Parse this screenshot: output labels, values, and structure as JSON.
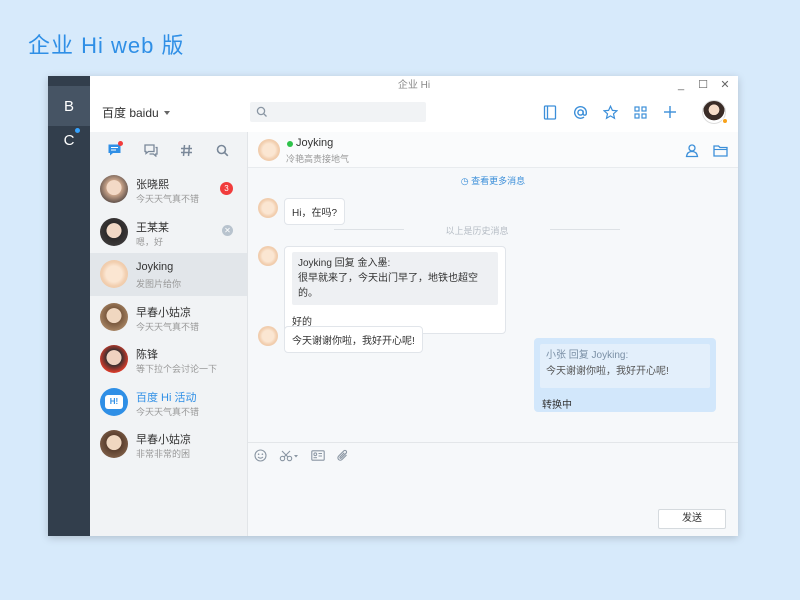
{
  "page_title": "企业 Hi web 版",
  "window": {
    "title": "企业 Hi",
    "controls": [
      "_",
      "☐",
      "✕"
    ]
  },
  "rail": {
    "items": [
      {
        "label": "B",
        "active": true,
        "has_dot": false
      },
      {
        "label": "C",
        "active": false,
        "has_dot": true
      }
    ]
  },
  "topbar": {
    "org_name": "百度 baidu",
    "search_placeholder": ""
  },
  "left_tabs": [
    "chat-icon",
    "group-chat-icon",
    "hashtag-icon",
    "search-icon"
  ],
  "conversations": [
    {
      "name": "张晓熙",
      "message": "今天天气真不错",
      "badge": "3",
      "avatar": "face-a"
    },
    {
      "name": "王某某",
      "message": "嗯，好",
      "mute": "✕",
      "avatar": "face-b"
    },
    {
      "name": "Joyking",
      "message": "发图片给你",
      "active": true,
      "avatar": "face-j"
    },
    {
      "name": "早春小姑凉",
      "message": "今天天气真不错",
      "avatar": "face-c"
    },
    {
      "name": "陈锋",
      "message": "等下拉个会讨论一下",
      "avatar": "face-d"
    },
    {
      "name": "百度 Hi 活动",
      "message": "今天天气真不错",
      "avatar": "hi-logo",
      "blue": true
    },
    {
      "name": "早春小姑凉",
      "message": "非常非常的困",
      "avatar": "face-e"
    }
  ],
  "chat": {
    "contact_name": "Joyking",
    "contact_signature": "冷艳高贵接地气",
    "online_status_color": "#2ec24a",
    "more_messages": "查看更多消息",
    "history_divider": "以上是历史消息",
    "messages": [
      {
        "text": "Hi，在吗?"
      },
      {
        "quote_header": "Joyking 回复 金入墨:",
        "quote_body": "很早就来了，今天出门早了，地铁也超空的。",
        "text": "好的"
      },
      {
        "text": "今天谢谢你啦，我好开心呢!"
      }
    ],
    "my_message": {
      "quote_header": "小张 回复 Joyking:",
      "quote_body": "今天谢谢你啦，我好开心呢!",
      "text": "转换中"
    },
    "send_label": "发送"
  },
  "colors": {
    "accent": "#2f8fe6",
    "rail_bg": "#323e4c",
    "badge_red": "#f13c3c"
  }
}
